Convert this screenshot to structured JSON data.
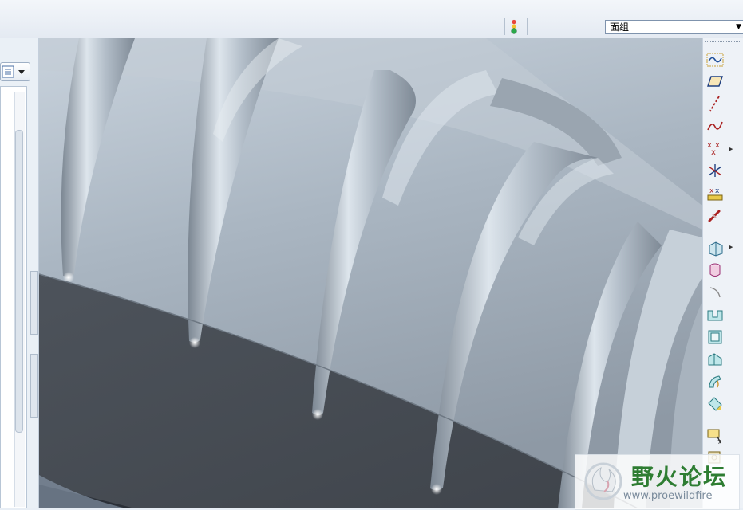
{
  "filter": {
    "selected": "面组",
    "arrow": "▼"
  },
  "watermark": {
    "title": "野火论坛",
    "url": "www.proewildfire"
  },
  "colors": {
    "toolbar_bg": "#e4eaf2",
    "model_light": "#b9c6d2",
    "model_dark": "#4c525b",
    "watermark_green": "#2e7d32"
  },
  "right_toolbar": {
    "icons": [
      "sketched-curve-icon",
      "datum-plane-icon",
      "datum-axis-icon",
      "datum-curve-icon",
      "datum-point-icon",
      "datum-csys-icon",
      "analysis-icon",
      "chain-link-icon",
      "extrude-icon",
      "revolve-icon",
      "variable-sweep-icon",
      "hole-icon",
      "shell-icon",
      "rib-icon",
      "draft-icon",
      "round-icon",
      "chamfer-icon",
      "note-icon",
      "annotation-icon"
    ]
  },
  "left_panel": {
    "icons": [
      "model-tree-settings-icon"
    ]
  }
}
